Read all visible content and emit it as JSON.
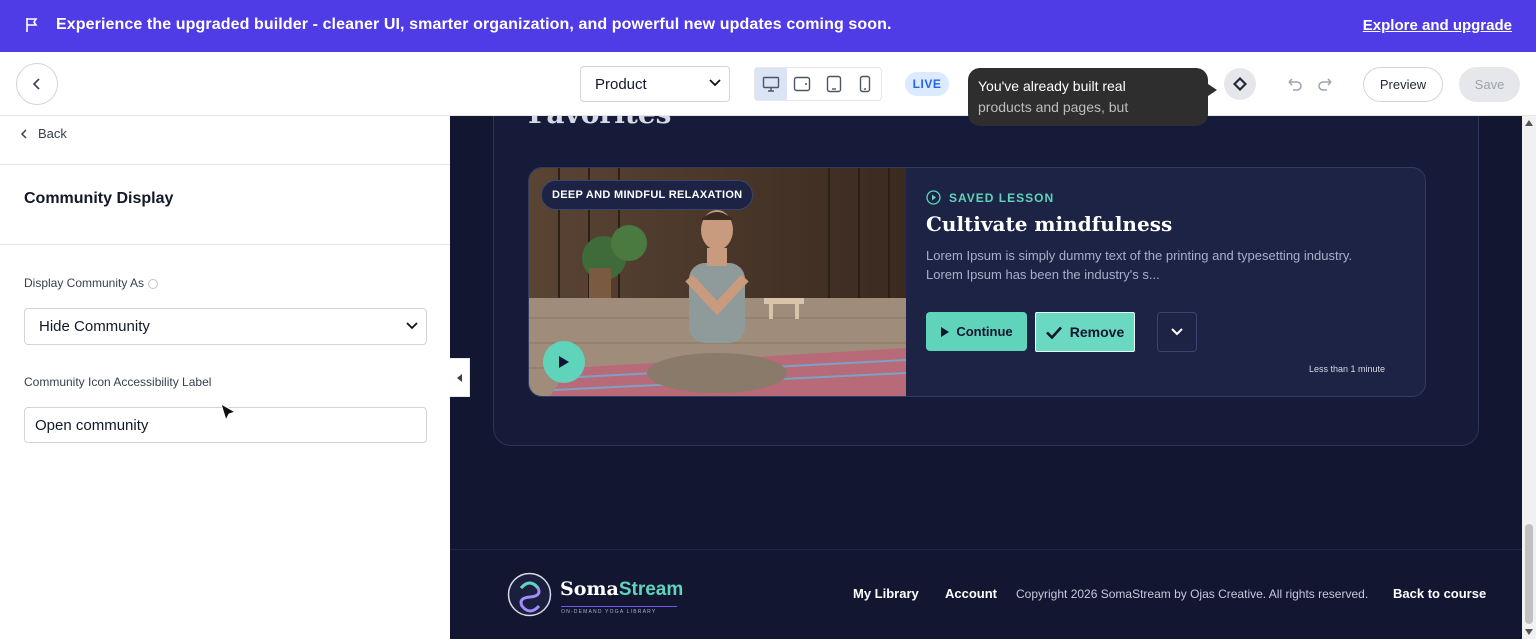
{
  "banner": {
    "message": "Experience the upgraded builder - cleaner UI, smarter organization, and powerful new updates coming soon.",
    "cta": "Explore and upgrade"
  },
  "toolbar": {
    "page_select": "Product",
    "live_badge": "LIVE",
    "tooltip_line1": "You've already built real",
    "tooltip_line2": "products and pages, but",
    "preview": "Preview",
    "save": "Save",
    "devices": [
      "desktop-icon",
      "tablet-landscape-icon",
      "tablet-icon",
      "mobile-icon"
    ]
  },
  "left_panel": {
    "back": "Back",
    "section_title": "Community Display",
    "display_as_label": "Display Community As",
    "display_as_value": "Hide Community",
    "accessibility_label": "Community Icon Accessibility Label",
    "accessibility_value": "Open community"
  },
  "preview": {
    "section_title": "Favorites",
    "card": {
      "tag": "DEEP AND MINDFUL RELAXATION",
      "saved_label": "SAVED LESSON",
      "title": "Cultivate mindfulness",
      "description_line1": "Lorem Ipsum is simply dummy text of the printing and typesetting industry.",
      "description_line2": "Lorem Ipsum has been the industry's s...",
      "continue": "Continue",
      "remove": "Remove",
      "duration": "Less than 1 minute"
    },
    "footer": {
      "brand_main": "Soma",
      "brand_accent": "Stream",
      "brand_sub": "ON-DEMAND YOGA LIBRARY",
      "links": [
        "My Library",
        "Account"
      ],
      "copyright": "Copyright 2026 SomaStream by Ojas Creative. All rights reserved.",
      "back_link": "Back to course"
    }
  },
  "colors": {
    "banner": "#4f3ce6",
    "canvas_bg": "#121631",
    "accent": "#5fd4bb",
    "live_badge": "#2563eb"
  }
}
